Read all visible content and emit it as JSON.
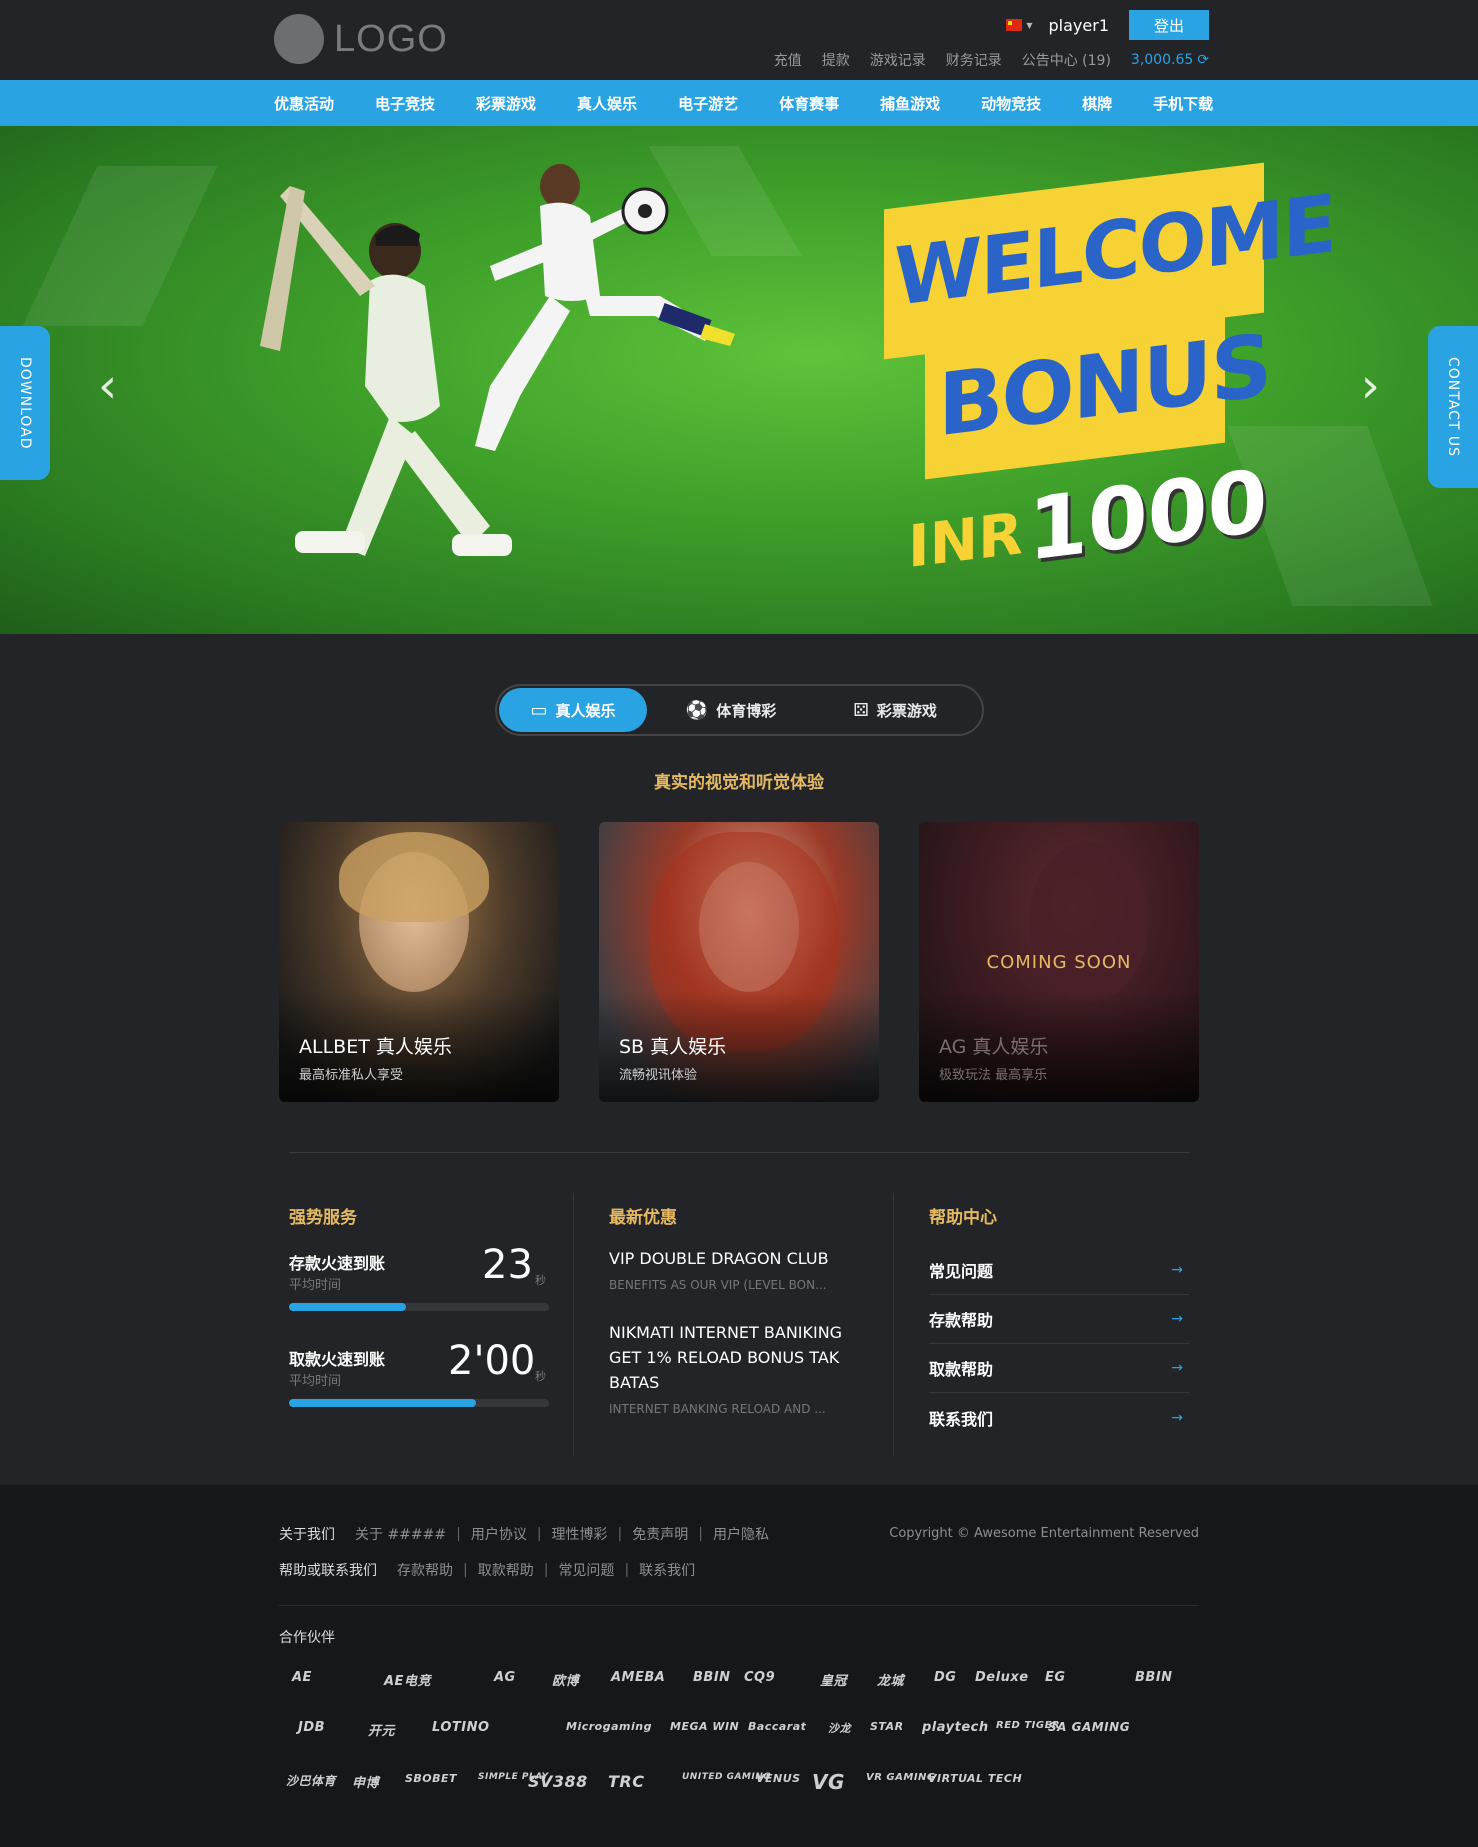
{
  "header": {
    "logo_text": "LOGO",
    "username": "player1",
    "logout_label": "登出",
    "links": [
      "充值",
      "提款",
      "游戏记录",
      "财务记录",
      "公告中心 (19)"
    ],
    "balance": "3,000.65",
    "accent_color": "#2aa3e3"
  },
  "nav": {
    "items": [
      "优惠活动",
      "电子竞技",
      "彩票游戏",
      "真人娱乐",
      "电子游艺",
      "体育赛事",
      "捕鱼游戏",
      "动物竞技",
      "棋牌",
      "手机下载"
    ]
  },
  "banner": {
    "download_label": "DOWNLOAD",
    "contact_label": "CONTACT US",
    "line1": "WELCOME",
    "line2": "BONUS",
    "currency": "INR",
    "amount": "1000"
  },
  "tabs": [
    {
      "label": "真人娱乐",
      "icon": "video-camera-icon"
    },
    {
      "label": "体育博彩",
      "icon": "soccer-ball-icon"
    },
    {
      "label": "彩票游戏",
      "icon": "dice-icon"
    }
  ],
  "section_subtitle": "真实的视觉和听觉体验",
  "cards": [
    {
      "title": "ALLBET 真人娱乐",
      "desc": "最高标准私人享受"
    },
    {
      "title": "SB 真人娱乐",
      "desc": "流畅视讯体验"
    },
    {
      "title": "AG 真人娱乐",
      "desc": "极致玩法 最高享乐",
      "overlay": "COMING SOON"
    }
  ],
  "services": {
    "title": "强势服务",
    "items": [
      {
        "label": "存款火速到账",
        "sub": "平均时间",
        "value": "23",
        "unit": "秒",
        "progress": 0.45
      },
      {
        "label": "取款火速到账",
        "sub": "平均时间",
        "value": "2'00",
        "unit": "秒",
        "progress": 0.72
      }
    ]
  },
  "promotions": {
    "title": "最新优惠",
    "items": [
      {
        "title": "VIP DOUBLE DRAGON CLUB",
        "sub": "BENEFITS AS OUR VIP (LEVEL BON..."
      },
      {
        "title": "NIKMATI INTERNET BANIKING GET 1% RELOAD BONUS TAK BATAS",
        "sub": "INTERNET BANKING RELOAD AND ..."
      }
    ]
  },
  "help": {
    "title": "帮助中心",
    "items": [
      "常见问题",
      "存款帮助",
      "取款帮助",
      "联系我们"
    ]
  },
  "footer": {
    "row1_head": "关于我们",
    "row1_links": [
      "关于 #####",
      "用户协议",
      "理性博彩",
      "免责声明",
      "用户隐私"
    ],
    "row2_head": "帮助或联系我们",
    "row2_links": [
      "存款帮助",
      "取款帮助",
      "常见问题",
      "联系我们"
    ],
    "copyright": "Copyright © Awesome Entertainment Reserved",
    "partners_title": "合作伙伴",
    "partners_row1": [
      "AE",
      "AE电竞",
      "AG",
      "欧博",
      "AMEBA",
      "BBIN",
      "CQ9",
      "皇冠",
      "龙城",
      "DG",
      "Deluxe",
      "EG",
      "BBIN"
    ],
    "partners_row2": [
      "JDB",
      "开元",
      "LOTINO",
      "Microgaming",
      "MEGA WIN",
      "Baccarat",
      "沙龙",
      "STAR",
      "playtech",
      "RED TIGER",
      "SA GAMING"
    ],
    "partners_row3": [
      "沙巴体育",
      "申博",
      "SBOBET",
      "SIMPLE PLAY",
      "SV388",
      "TRC",
      "UNITED GAMING",
      "VENUS",
      "VG",
      "VR GAMING",
      "VIRTUAL TECH"
    ]
  }
}
